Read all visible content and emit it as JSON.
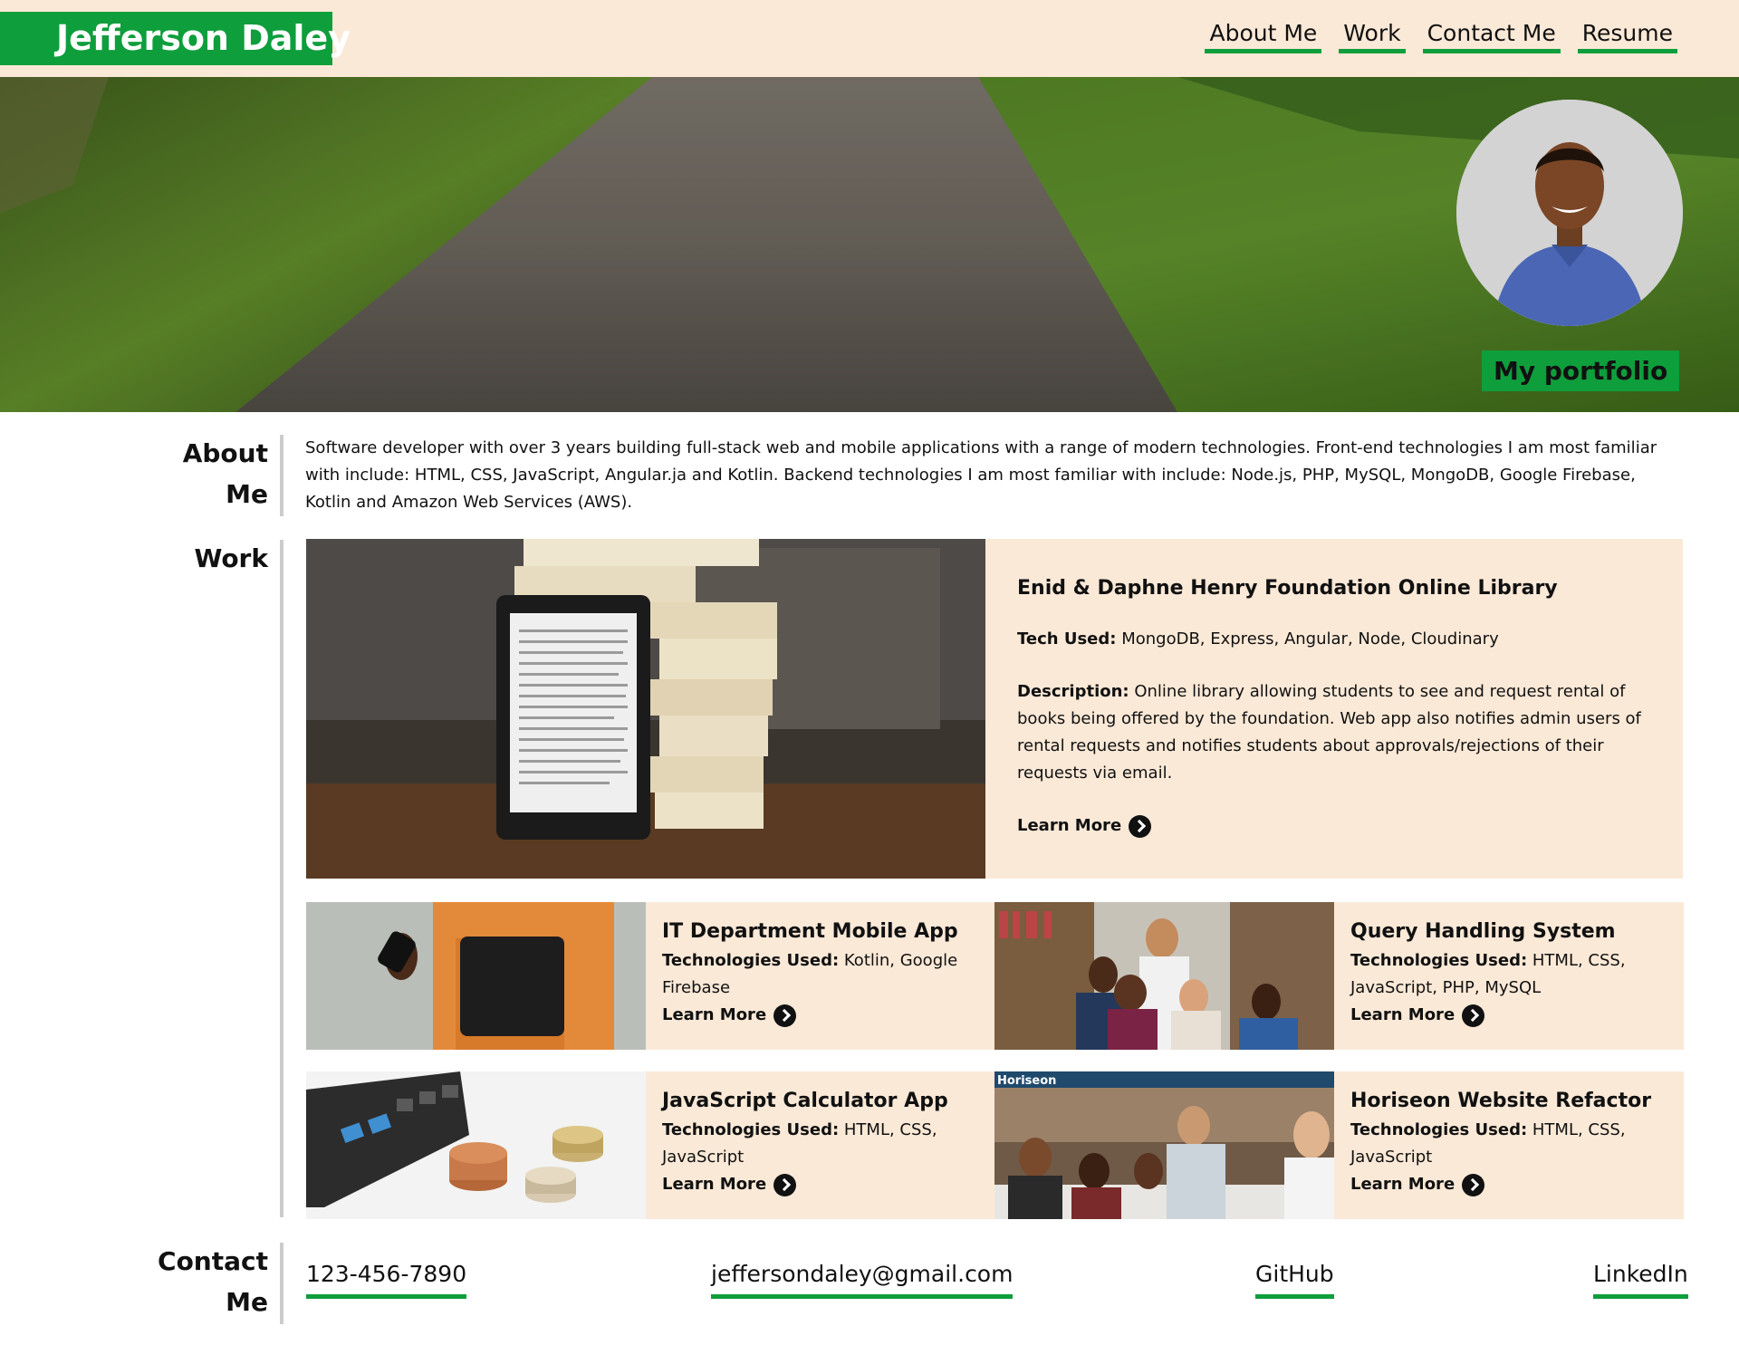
{
  "header": {
    "brand": "Jefferson Daley",
    "nav": [
      "About Me",
      "Work",
      "Contact Me",
      "Resume"
    ],
    "accent_color": "#0f9e3c",
    "background_color": "#fbe9d7"
  },
  "hero": {
    "tagline": "My portfolio",
    "image": "road-through-grass",
    "avatar": "profile-photo"
  },
  "about": {
    "label_line1": "About",
    "label_line2": "Me",
    "text": "Software developer with over 3 years building full-stack web and mobile applications with a range of modern technologies. Front-end technologies I am most familiar with include: HTML, CSS, JavaScript, Angular.ja and Kotlin. Backend technologies I am most familiar with include: Node.js, PHP, MySQL, MongoDB, Google Firebase, Kotlin and Amazon Web Services (AWS)."
  },
  "work": {
    "label": "Work",
    "featured": {
      "title": "Enid & Daphne Henry Foundation Online Library",
      "tech_label": "Tech Used:",
      "tech": " MongoDB, Express, Angular, Node, Cloudinary",
      "desc_label": "Description:",
      "desc": " Online library allowing students to see and request rental of books being offered by the foundation. Web app also notifies admin users of rental requests and notifies students about approvals/rejections of their requests via email.",
      "learn_more": "Learn More",
      "image": "tablet-and-books"
    },
    "projects": [
      {
        "title": "IT Department Mobile App",
        "tech_label": "Technologies Used:",
        "tech": " Kotlin, Google Firebase",
        "learn_more": "Learn More",
        "image": "person-with-phone"
      },
      {
        "title": "Query Handling System",
        "tech_label": "Technologies Used:",
        "tech": " HTML, CSS, JavaScript, PHP, MySQL",
        "learn_more": "Learn More",
        "image": "students-high-five"
      },
      {
        "title": "JavaScript Calculator App",
        "tech_label": "Technologies Used:",
        "tech": " HTML, CSS, JavaScript",
        "learn_more": "Learn More",
        "image": "calculator-and-coins"
      },
      {
        "title": "Horiseon Website Refactor",
        "tech_label": "Technologies Used:",
        "tech": " HTML, CSS, JavaScript",
        "learn_more": "Learn More",
        "image": "team-at-table",
        "image_caption": "Horiseon"
      }
    ]
  },
  "contact": {
    "label_line1": "Contact",
    "label_line2": "Me",
    "phone": "123-456-7890",
    "email": "jeffersondaley@gmail.com",
    "github": "GitHub",
    "linkedin": "LinkedIn"
  }
}
